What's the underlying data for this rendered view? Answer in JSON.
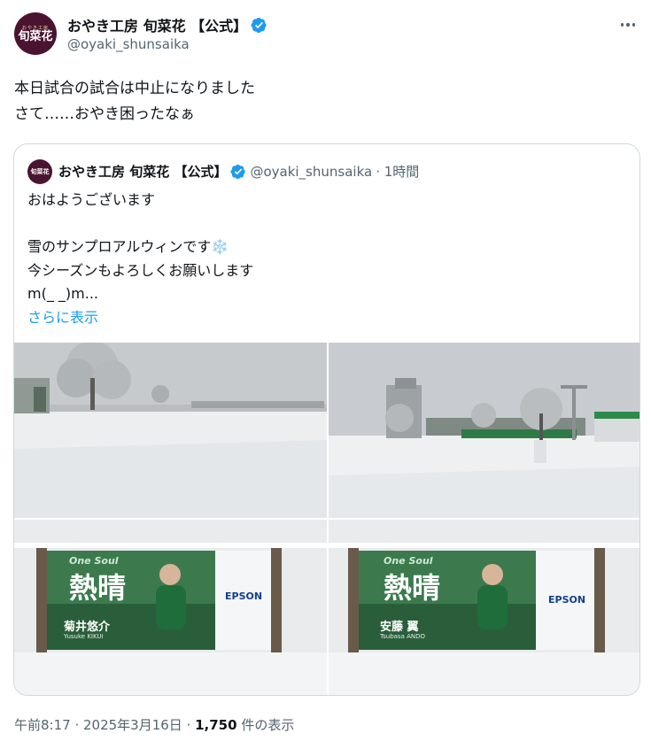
{
  "tweet": {
    "author": {
      "name": "おやき工房 旬菜花 【公式】",
      "handle": "@oyaki_shunsaika",
      "avatar_small_text": "おやき工房",
      "avatar_big_text": "旬菜花"
    },
    "text_lines": [
      "本日試合の試合は中止になりました",
      "さて……おやき困ったなぁ"
    ],
    "timestamp": "午前8:17 · 2025年3月16日 · ",
    "views_count": "1,750",
    "views_label": " 件の表示"
  },
  "quote": {
    "author_name": "おやき工房 旬菜花 【公式】",
    "author_handle": "@oyaki_shunsaika",
    "time_ago": " · 1時間",
    "text_lines": [
      "おはようございます",
      "",
      "雪のサンプロアルウィンです❄️",
      "今シーズンもよろしくお願いします",
      "m(_ _)m..."
    ],
    "show_more": "さらに表示",
    "photos": [
      {
        "alt": "snowy field with trees"
      },
      {
        "alt": "snowy stadium entrance"
      },
      {
        "alt": "banner One Soul 熱晴 菊井悠介",
        "banner_top": "One Soul",
        "banner_big": "熱晴",
        "player_name": "菊井悠介",
        "player_roman": "Yusuke KIKUI",
        "sponsor": "EPSON"
      },
      {
        "alt": "banner One Soul 熱晴 安藤翼",
        "banner_top": "One Soul",
        "banner_big": "熱晴",
        "player_name": "安藤 翼",
        "player_roman": "Tsubasa ANDO",
        "sponsor": "EPSON"
      }
    ]
  },
  "colors": {
    "text": "#0f1419",
    "secondary": "#536471",
    "link": "#1d9bf0",
    "border": "#cfd9de",
    "verified": "#1d9bf0",
    "avatar_bg": "#4a1430"
  },
  "icons": {
    "verified": "verified-badge-icon",
    "more": "more-options-icon"
  }
}
